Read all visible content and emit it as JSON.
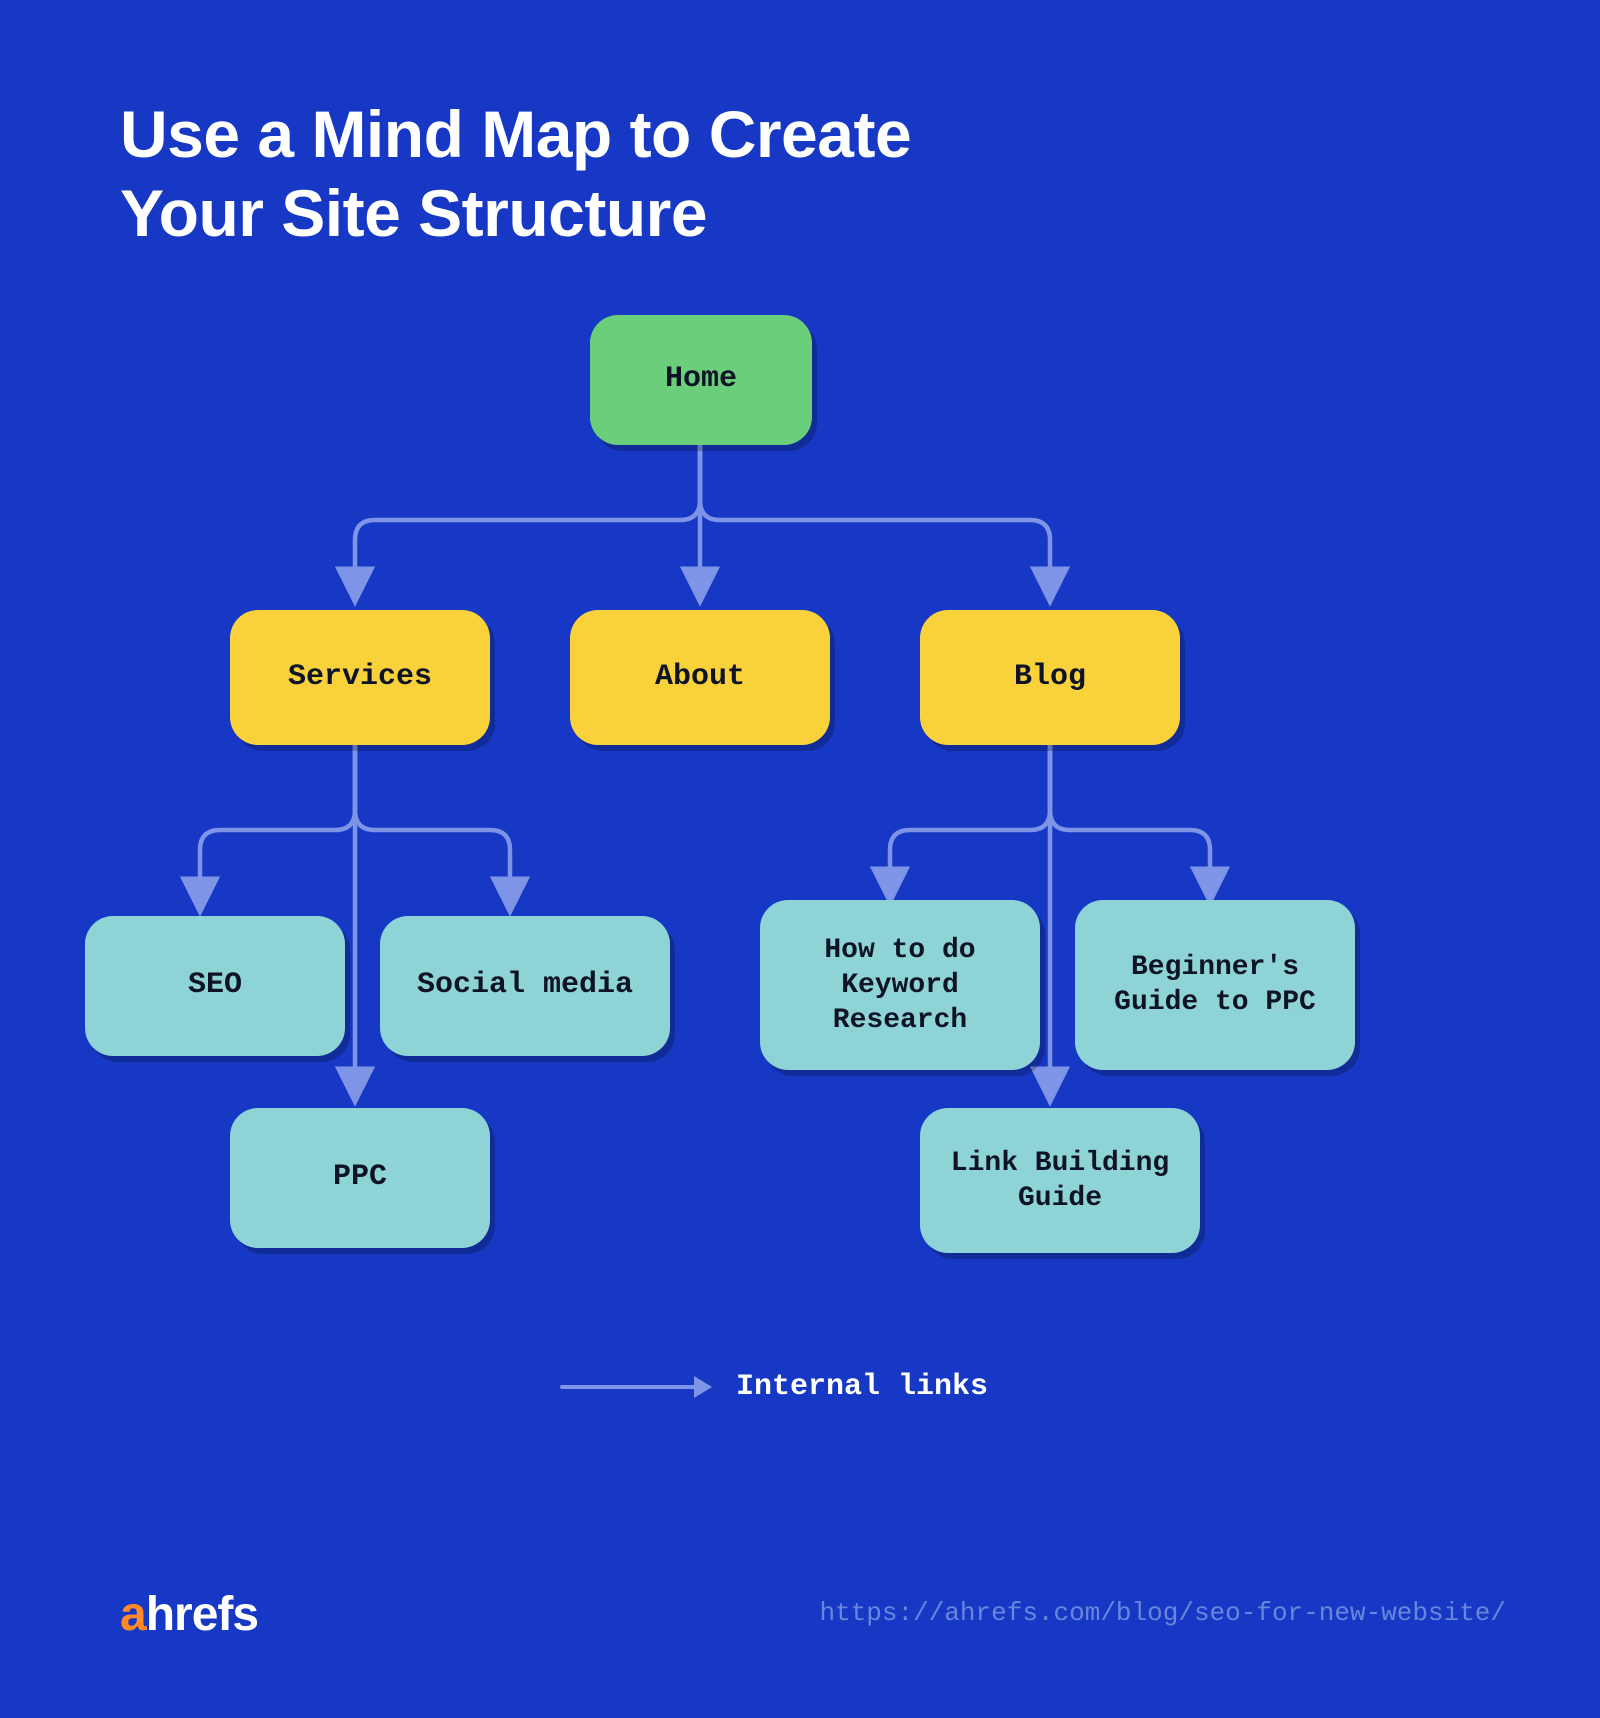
{
  "title_line1": "Use a Mind Map to Create",
  "title_line2": "Your Site Structure",
  "nodes": {
    "home": "Home",
    "services": "Services",
    "about": "About",
    "blog": "Blog",
    "seo": "SEO",
    "social": "Social media",
    "ppc": "PPC",
    "kw": "How to do Keyword Research",
    "begppc": "Beginner's Guide to PPC",
    "linkb": "Link Building Guide"
  },
  "legend_label": "Internal links",
  "brand": {
    "accent": "a",
    "rest": "hrefs"
  },
  "source_url": "https://ahrefs.com/blog/seo-for-new-website/",
  "colors": {
    "bg": "#1638c4",
    "green": "#6bce7a",
    "yellow": "#f9d13b",
    "lightblue": "#8ed3d6",
    "connector": "#7e94e6",
    "brand_accent": "#ff8a26"
  }
}
